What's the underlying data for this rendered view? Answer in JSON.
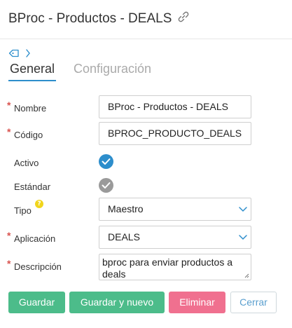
{
  "header": {
    "title": "BProc - Productos - DEALS",
    "link_icon": "link-icon"
  },
  "breadcrumb": {
    "tag_icon": "tag-icon",
    "chevron_icon": "chevron-right-icon"
  },
  "tabs": [
    {
      "label": "General",
      "active": true
    },
    {
      "label": "Configuración",
      "active": false
    }
  ],
  "form": {
    "nombre": {
      "label": "Nombre",
      "required": true,
      "value": "BProc - Productos - DEALS"
    },
    "codigo": {
      "label": "Código",
      "required": true,
      "value": "BPROC_PRODUCTO_DEALS"
    },
    "activo": {
      "label": "Activo",
      "checked": true
    },
    "estandar": {
      "label": "Estándar",
      "checked": true,
      "disabled": true
    },
    "tipo": {
      "label": "Tipo",
      "help": "?",
      "value": "Maestro"
    },
    "aplicacion": {
      "label": "Aplicación",
      "required": true,
      "value": "DEALS"
    },
    "descripcion": {
      "label": "Descripción",
      "required": true,
      "value": "bproc para enviar productos a deals"
    }
  },
  "buttons": {
    "guardar": "Guardar",
    "guardar_nuevo": "Guardar y nuevo",
    "eliminar": "Eliminar",
    "cerrar": "Cerrar"
  },
  "colors": {
    "accent": "#2d8ecc",
    "required": "#d9534f",
    "green_button": "#4cbc8a",
    "delete_button": "#f0708f",
    "help_badge": "#f1d51c"
  }
}
